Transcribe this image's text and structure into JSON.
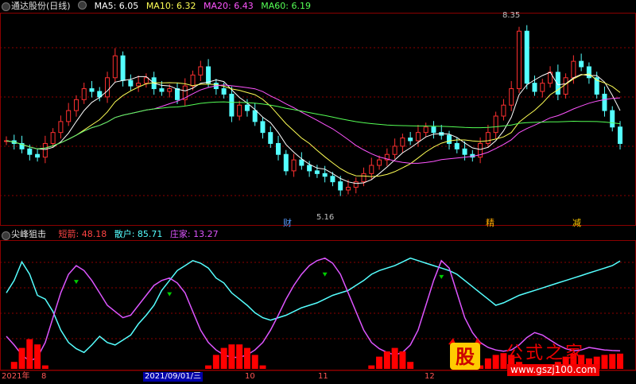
{
  "top_header": {
    "title": "通达股份(日线)",
    "ma": [
      {
        "label": "MA5: 6.05",
        "color": "#ffffff"
      },
      {
        "label": "MA10: 6.32",
        "color": "#ffff55"
      },
      {
        "label": "MA20: 6.43",
        "color": "#ff55ff"
      },
      {
        "label": "MA60: 6.19",
        "color": "#55ff55"
      }
    ]
  },
  "bottom_header": {
    "title": "尖峰狙击",
    "items": [
      {
        "label": "短箭: 48.18",
        "color": "#ff4444"
      },
      {
        "label": "散户: 85.71",
        "color": "#55ffff"
      },
      {
        "label": "庄家: 13.27",
        "color": "#dd55ff"
      }
    ]
  },
  "annotations": {
    "high_label": "8.35",
    "low_label": "5.16",
    "markers": [
      {
        "text": "财",
        "color": "#5599ff"
      },
      {
        "text": "精",
        "color": "#ffaa00"
      },
      {
        "text": "减",
        "color": "#ffcc00"
      }
    ]
  },
  "x_axis": {
    "labels": [
      "2021年",
      "8",
      "2021/09/01/三",
      "10",
      "11",
      "12"
    ]
  },
  "watermark": {
    "logo_text": "股",
    "title": "公式之家",
    "url": "www.gszj100.com"
  },
  "colors": {
    "up": "#ff3030",
    "down": "#54ffff",
    "grid": "#8b0000",
    "ma5": "#ffffff",
    "ma10": "#ffff55",
    "ma20": "#ff55ff",
    "ma60": "#55ff55",
    "retail": "#55ffff",
    "dealer": "#dd55ff",
    "bar": "#ff0000"
  },
  "chart_data": [
    {
      "type": "candlestick",
      "title": "通达股份(日线)",
      "series_close": [
        6.35,
        6.3,
        6.2,
        6.1,
        6.05,
        6.3,
        6.5,
        6.7,
        6.9,
        7.1,
        7.3,
        7.25,
        7.15,
        7.5,
        7.9,
        7.45,
        7.35,
        7.4,
        7.5,
        7.3,
        7.25,
        7.3,
        7.1,
        7.35,
        7.55,
        7.7,
        7.4,
        7.3,
        7.2,
        6.8,
        7.0,
        6.9,
        6.7,
        6.5,
        6.3,
        6.1,
        5.8,
        6.0,
        5.9,
        5.8,
        5.75,
        5.7,
        5.6,
        5.45,
        5.5,
        5.6,
        5.75,
        5.9,
        6.0,
        6.1,
        6.25,
        6.4,
        6.35,
        6.5,
        6.6,
        6.5,
        6.45,
        6.3,
        6.2,
        6.1,
        6.05,
        6.3,
        6.5,
        6.8,
        7.0,
        7.3,
        8.35,
        7.4,
        7.25,
        7.4,
        7.6,
        7.2,
        7.5,
        7.8,
        7.7,
        7.5,
        7.2,
        6.9,
        6.6,
        6.3
      ],
      "ma_values": {
        "MA5": 6.05,
        "MA10": 6.32,
        "MA20": 6.43,
        "MA60": 6.19
      },
      "high": 8.35,
      "low": 5.16
    },
    {
      "type": "line",
      "title": "尖峰狙击",
      "series": [
        {
          "name": "散户",
          "values": [
            60,
            70,
            85,
            75,
            58,
            55,
            45,
            30,
            20,
            15,
            12,
            18,
            25,
            20,
            18,
            22,
            26,
            35,
            42,
            50,
            62,
            70,
            78,
            82,
            86,
            84,
            80,
            72,
            68,
            60,
            55,
            50,
            44,
            40,
            38,
            40,
            42,
            45,
            48,
            50,
            52,
            55,
            58,
            60,
            62,
            66,
            70,
            75,
            78,
            80,
            82,
            85,
            88,
            86,
            84,
            82,
            80,
            78,
            75,
            70,
            65,
            60,
            55,
            50,
            52,
            55,
            58,
            60,
            62,
            64,
            66,
            68,
            70,
            72,
            74,
            76,
            78,
            80,
            82,
            85.71
          ]
        },
        {
          "name": "庄家",
          "values": [
            25,
            18,
            10,
            5,
            8,
            20,
            40,
            60,
            75,
            82,
            78,
            70,
            60,
            50,
            45,
            40,
            42,
            50,
            58,
            66,
            70,
            72,
            68,
            60,
            45,
            30,
            20,
            14,
            10,
            8,
            8,
            10,
            14,
            20,
            30,
            42,
            55,
            66,
            75,
            82,
            86,
            88,
            84,
            75,
            60,
            45,
            30,
            20,
            15,
            12,
            10,
            12,
            18,
            30,
            50,
            70,
            86,
            80,
            60,
            40,
            28,
            20,
            16,
            14,
            13,
            14,
            18,
            24,
            28,
            26,
            22,
            18,
            15,
            13.27,
            14,
            16,
            15,
            14,
            13.5,
            13.27
          ]
        }
      ],
      "ylim": [
        0,
        100
      ]
    }
  ]
}
